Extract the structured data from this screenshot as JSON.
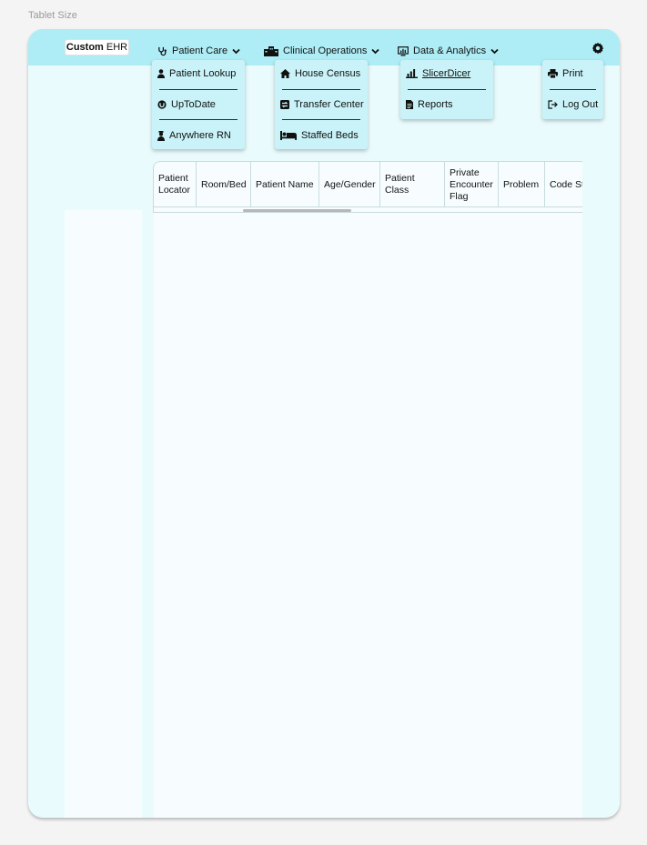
{
  "frame_label": "Tablet Size",
  "logo": {
    "bold": "Custom",
    "rest": " EHR"
  },
  "nav": {
    "patient_care": "Patient Care",
    "clinical_operations": "Clinical Operations",
    "data_analytics": "Data & Analytics"
  },
  "menus": {
    "patient_care": {
      "patient_lookup": "Patient Lookup",
      "uptodate": "UpToDate",
      "anywhere_rn": "Anywhere RN"
    },
    "clinical_operations": {
      "house_census": "House Census",
      "transfer_center": "Transfer Center",
      "staffed_beds": "Staffed Beds"
    },
    "data_analytics": {
      "slicerdicer": "SlicerDicer",
      "reports": "Reports"
    },
    "settings": {
      "print": "Print",
      "log_out": "Log Out"
    }
  },
  "table": {
    "columns": [
      "Patient Locator",
      "Room/Bed",
      "Patient Name",
      "Age/Gender",
      "Patient Class",
      "Private Encounter Flag",
      "Problem",
      "Code Status"
    ]
  },
  "icons": {
    "patient_care": "stethoscope-icon",
    "clinical_operations": "building-icon",
    "data_analytics": "monitor-chart-icon",
    "settings": "gear-icon"
  },
  "colors": {
    "topbar": "#aeedf5",
    "dropdown": "#c9f3f8",
    "device_bg": "#e9fbfd"
  }
}
